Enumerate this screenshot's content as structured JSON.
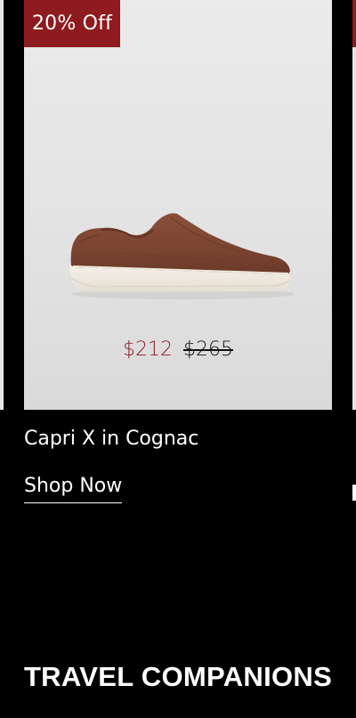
{
  "product": {
    "badge": "20% Off",
    "sale_price": "$212",
    "original_price": "$265",
    "name": "Capri X in Cognac",
    "cta_label": "Shop Now",
    "image_icon": "sneaker-icon",
    "accent_color": "#8e1b1f",
    "shoe_color": "#7a4430"
  },
  "section": {
    "heading": "TRAVEL COMPANIONS"
  }
}
